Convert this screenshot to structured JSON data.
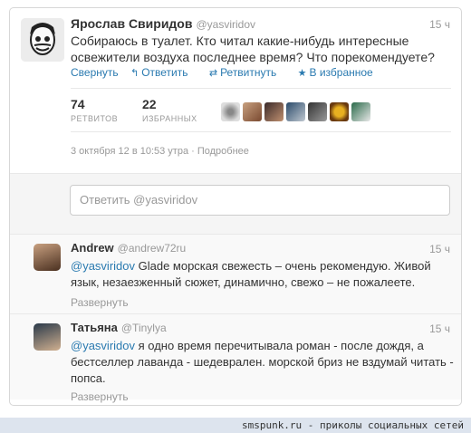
{
  "main_tweet": {
    "author": "Ярослав Свиридов",
    "handle": "@yasviridov",
    "time": "15 ч",
    "text": "Собираюсь в туалет. Кто читал какие-нибудь интересные освежители воздуха последнее время? Что порекомендуете?",
    "actions": {
      "collapse": "Свернуть",
      "reply": "Ответить",
      "retweet": "Ретвитнуть",
      "favorite": "В избранное"
    },
    "retweets_count": "74",
    "retweets_label": "РЕТВИТОВ",
    "favorites_count": "22",
    "favorites_label": "ИЗБРАННЫХ",
    "date": "3 октября 12 в 10:53 утра · Подробнее"
  },
  "reply_placeholder": "Ответить @yasviridov",
  "replies": [
    {
      "author": "Andrew",
      "handle": "@andrew72ru",
      "time": "15 ч",
      "mention": "@yasviridov",
      "text": " Glade морская свежесть – очень рекомендую. Живой язык, незаезженный сюжет, динамично, свежо – не пожалеете.",
      "expand": "Развернуть"
    },
    {
      "author": "Татьяна",
      "handle": "@Tinylya",
      "time": "15 ч",
      "mention": "@yasviridov",
      "text": " я одно время перечитывала роман - после дождя, а бестселлер лаванда - шедевралeн. морской бриз не вздумай читать - попса.",
      "expand": "Развернуть"
    }
  ],
  "footer": "smspunk.ru - приколы социальных сетей",
  "icons": [
    "reply-icon",
    "retweet-icon",
    "star-icon"
  ],
  "colors": {
    "link": "#2a7ab0",
    "muted": "#999999",
    "footer_bg": "#dde4ee"
  }
}
